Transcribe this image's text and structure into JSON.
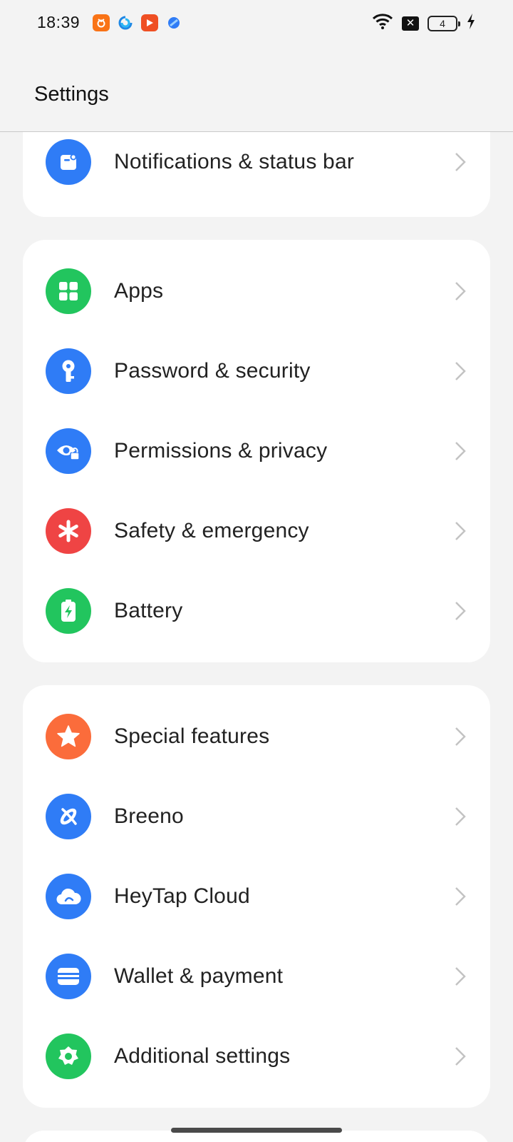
{
  "status_bar": {
    "time": "18:39",
    "notification_icons": [
      "app-orange-icon",
      "browser-icon",
      "video-player-icon",
      "blue-app-icon"
    ],
    "battery_level": "4",
    "charging": true
  },
  "header": {
    "title": "Settings"
  },
  "groups": [
    {
      "items": [
        {
          "label": "Notifications & status bar",
          "icon": "notification-icon",
          "color": "#2f7cf6"
        }
      ]
    },
    {
      "items": [
        {
          "label": "Apps",
          "icon": "apps-icon",
          "color": "#22c55e"
        },
        {
          "label": "Password & security",
          "icon": "key-icon",
          "color": "#2f7cf6"
        },
        {
          "label": "Permissions & privacy",
          "icon": "privacy-eye-icon",
          "color": "#2f7cf6"
        },
        {
          "label": "Safety & emergency",
          "icon": "asterisk-icon",
          "color": "#ef4444"
        },
        {
          "label": "Battery",
          "icon": "battery-icon",
          "color": "#22c55e"
        }
      ]
    },
    {
      "items": [
        {
          "label": "Special features",
          "icon": "star-icon",
          "color": "#fb6c3b"
        },
        {
          "label": "Breeno",
          "icon": "breeno-icon",
          "color": "#2f7cf6"
        },
        {
          "label": "HeyTap Cloud",
          "icon": "cloud-icon",
          "color": "#2f7cf6"
        },
        {
          "label": "Wallet & payment",
          "icon": "wallet-icon",
          "color": "#2f7cf6"
        },
        {
          "label": "Additional settings",
          "icon": "gear-icon",
          "color": "#22c55e"
        }
      ]
    }
  ]
}
